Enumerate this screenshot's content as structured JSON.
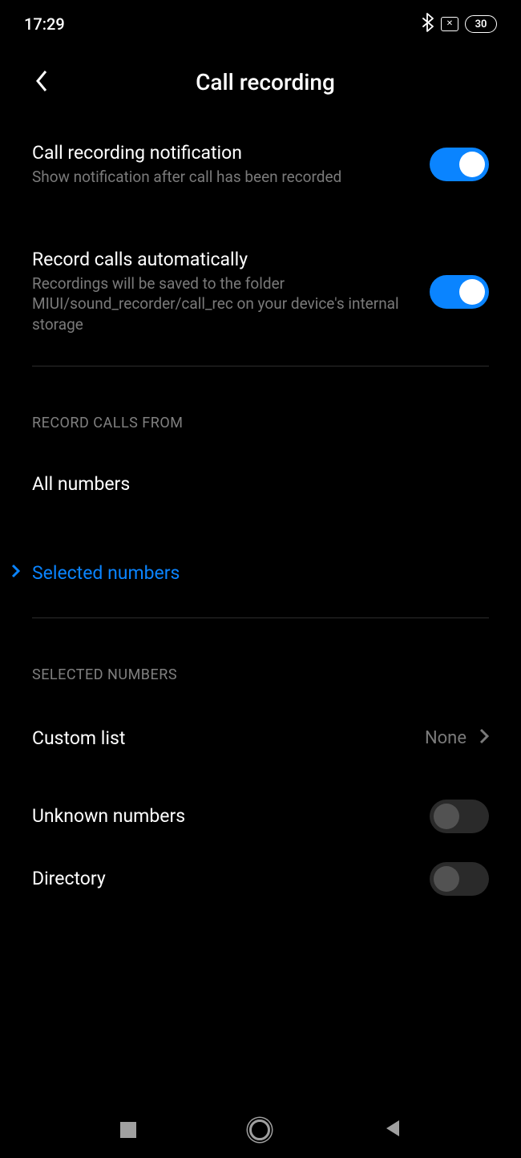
{
  "status": {
    "time": "17:29",
    "battery": "30"
  },
  "header": {
    "title": "Call recording"
  },
  "settings": {
    "notification": {
      "title": "Call recording notification",
      "subtitle": "Show notification after call has been recorded",
      "on": true
    },
    "auto_record": {
      "title": "Record calls automatically",
      "subtitle": "Recordings will be saved to the folder MIUI/sound_recorder/call_rec on your device's internal storage",
      "on": true
    }
  },
  "sections": {
    "record_from": {
      "header": "RECORD CALLS FROM",
      "options": {
        "all": "All numbers",
        "selected": "Selected numbers"
      }
    },
    "selected_numbers": {
      "header": "SELECTED NUMBERS",
      "custom_list": {
        "title": "Custom list",
        "value": "None"
      },
      "unknown": {
        "title": "Unknown numbers",
        "on": false
      },
      "directory": {
        "title": "Directory",
        "on": false
      }
    }
  }
}
